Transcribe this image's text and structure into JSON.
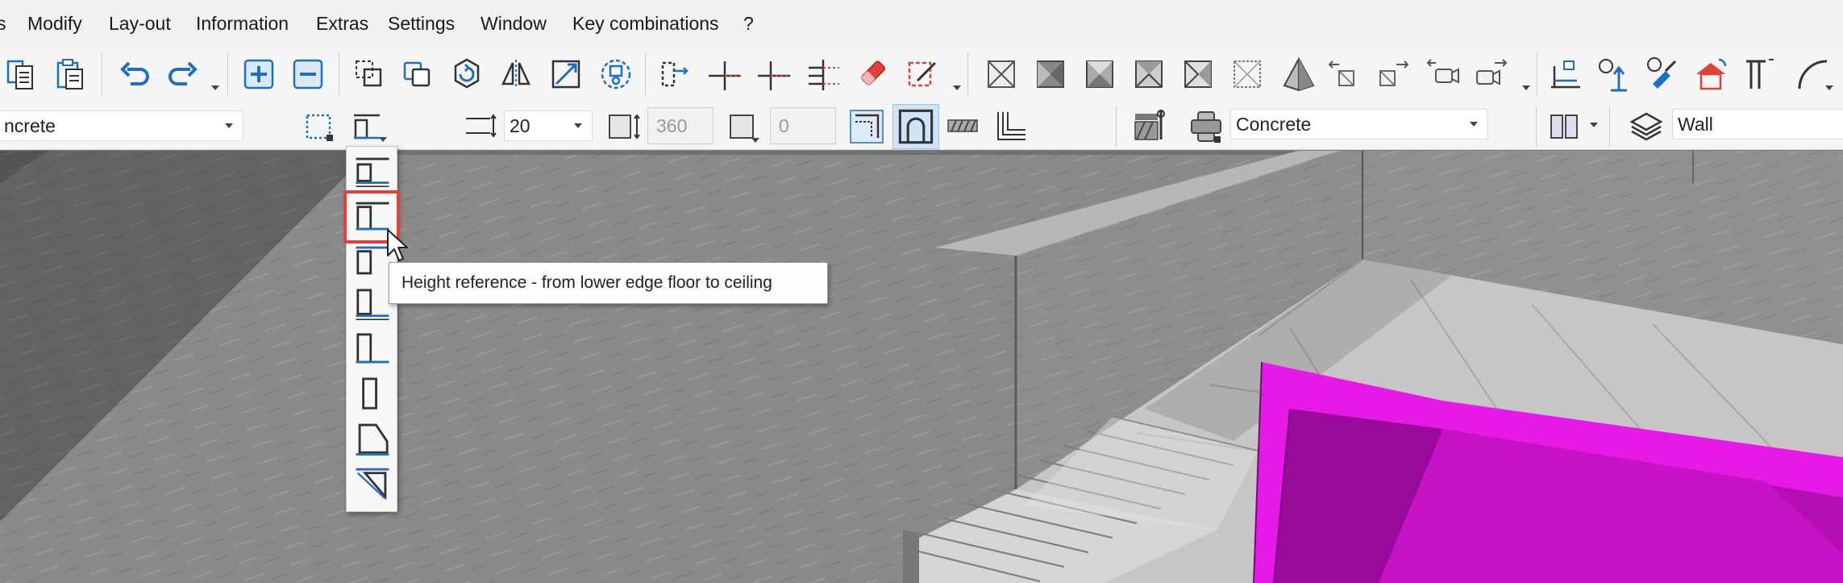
{
  "menu": {
    "items": [
      "s",
      "Modify",
      "Lay-out",
      "Information",
      "Extras",
      "Settings",
      "Window",
      "Key combinations",
      "?"
    ]
  },
  "toolbar": {
    "material_combo": "ncrete",
    "thickness_value": "20",
    "height_value": "360",
    "offset_value": "0",
    "surface_combo": "Concrete",
    "layer_combo": "Wall"
  },
  "flyout": {
    "tooltip": "Height reference - from lower edge floor to ceiling",
    "selected_index": 1
  },
  "colors": {
    "accent_blue": "#1f6fc1",
    "highlight_red": "#e2413b",
    "magenta": "#e619e6",
    "concrete": "#8a8a8a"
  }
}
